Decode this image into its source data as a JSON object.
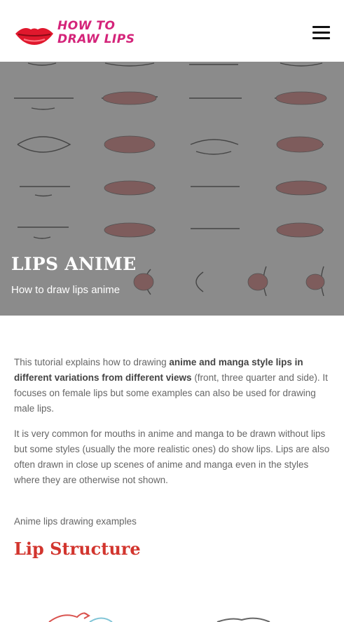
{
  "header": {
    "logo_line1": "HOW TO",
    "logo_line2": "DRAW LIPS",
    "logo_icon": "lips-logo-icon",
    "menu_icon": "hamburger-menu-icon"
  },
  "hero": {
    "title": "LIPS ANIME",
    "subtitle": "How to draw lips anime"
  },
  "article": {
    "p1_a": "This tutorial explains how to drawing ",
    "p1_bold": "anime and manga style lips in different variations from different views",
    "p1_b": " (front, three quarter and side). It focuses on female lips but some examples can also be used for drawing male lips.",
    "p2": "It is very common for mouths in anime and manga to be drawn without lips but some styles (usually the more realistic ones) do show lips. Lips are also often drawn in close up scenes of anime and manga even in the styles where they are otherwise not shown.",
    "caption": "Anime lips drawing examples",
    "section_heading": "Lip Structure"
  },
  "colors": {
    "brand": "#d4247a",
    "heading": "#d2352e",
    "lip_fill": "#c9706f"
  }
}
